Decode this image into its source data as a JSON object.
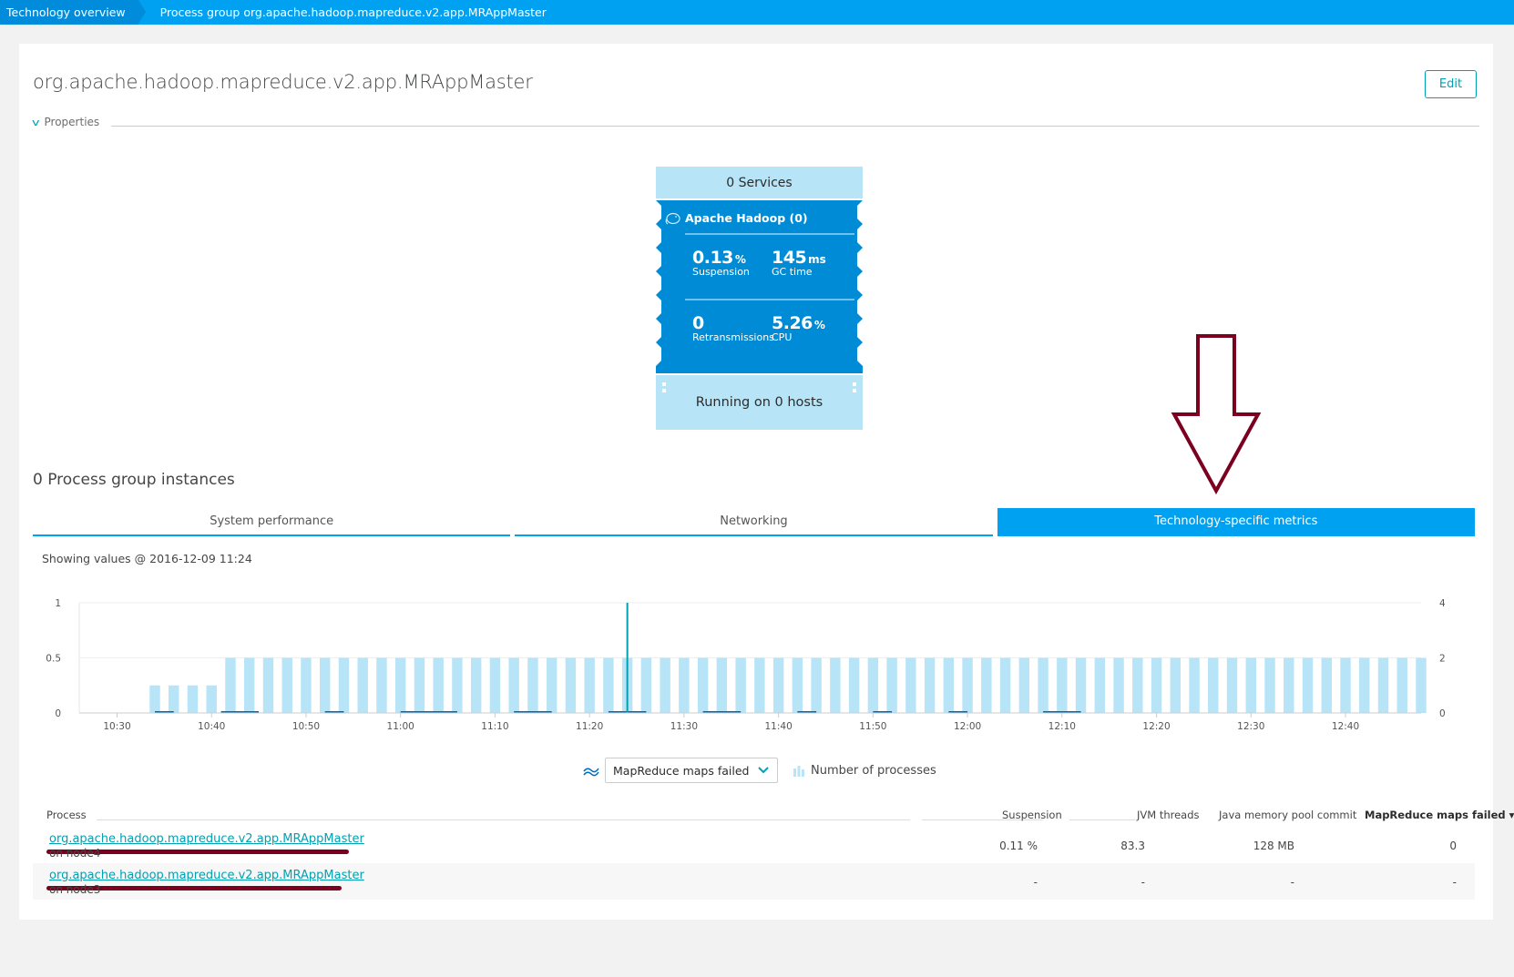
{
  "breadcrumb": {
    "items": [
      "Technology overview",
      "Process group org.apache.hadoop.mapreduce.v2.app.MRAppMaster"
    ]
  },
  "page": {
    "title": "org.apache.hadoop.mapreduce.v2.app.MRAppMaster",
    "edit_label": "Edit",
    "properties_label": "Properties"
  },
  "tile": {
    "services": "0 Services",
    "technology": "Apache Hadoop (0)",
    "metrics": [
      {
        "value": "0.13",
        "unit": "%",
        "label": "Suspension"
      },
      {
        "value": "145",
        "unit": "ms",
        "label": "GC time"
      },
      {
        "value": "0",
        "unit": "",
        "label": "Retransmissions"
      },
      {
        "value": "5.26",
        "unit": "%",
        "label": "CPU"
      }
    ],
    "hosts": "Running on 0 hosts",
    "color": "#008bd6",
    "light_color": "#b7e4f7"
  },
  "instances": {
    "title": "0 Process group instances",
    "tabs": [
      {
        "label": "System performance",
        "active": false
      },
      {
        "label": "Networking",
        "active": false
      },
      {
        "label": "Technology-specific metrics",
        "active": true
      }
    ],
    "showing": "Showing values @ 2016-12-09 11:24"
  },
  "legend": {
    "selected_metric": "MapReduce maps failed",
    "bar_series": "Number of processes"
  },
  "chart_data": {
    "type": "bar",
    "title": "",
    "xlabel": "",
    "ylabel_left": "MapReduce maps failed",
    "ylabel_right": "Number of processes",
    "x_ticks": [
      "10:30",
      "10:40",
      "10:50",
      "11:00",
      "11:10",
      "11:20",
      "11:30",
      "11:40",
      "11:50",
      "12:00",
      "12:10",
      "12:20",
      "12:30",
      "12:40"
    ],
    "ylim_left": [
      0,
      1
    ],
    "yticks_left": [
      "0",
      "0.5",
      "1"
    ],
    "ylim_right": [
      0,
      4
    ],
    "yticks_right": [
      "0",
      "2",
      "4"
    ],
    "x_start": "10:26",
    "x_end": "12:48",
    "bar_interval_minutes": 2,
    "series": [
      {
        "name": "Number of processes",
        "axis": "right",
        "kind": "bar",
        "color": "#b7e4f7",
        "start": "10:34",
        "values": [
          1,
          1,
          1,
          1,
          2,
          2,
          2,
          2,
          2,
          2,
          2,
          2,
          2,
          2,
          2,
          2,
          2,
          2,
          2,
          2,
          2,
          2,
          2,
          2,
          2,
          2,
          2,
          2,
          2,
          2,
          2,
          2,
          2,
          2,
          2,
          2,
          2,
          2,
          2,
          2,
          2,
          2,
          2,
          2,
          2,
          2,
          2,
          2,
          2,
          2,
          2,
          2,
          2,
          2,
          2,
          2,
          2,
          2,
          2,
          2,
          2,
          2,
          2,
          2,
          2,
          2,
          2,
          2
        ]
      },
      {
        "name": "MapReduce maps failed",
        "axis": "left",
        "kind": "line",
        "color": "#006bba",
        "segments": [
          [
            "10:34",
            "10:36"
          ],
          [
            "10:41",
            "10:45"
          ],
          [
            "10:52",
            "10:54"
          ],
          [
            "11:00",
            "11:06"
          ],
          [
            "11:12",
            "11:16"
          ],
          [
            "11:22",
            "11:26"
          ],
          [
            "11:32",
            "11:36"
          ],
          [
            "11:42",
            "11:44"
          ],
          [
            "11:50",
            "11:52"
          ],
          [
            "11:58",
            "12:00"
          ],
          [
            "12:08",
            "12:12"
          ]
        ],
        "values_note": "0 throughout visible segments",
        "marker": {
          "time": "11:24",
          "value": 1,
          "color": "#00a1b2"
        }
      }
    ]
  },
  "table": {
    "headers": [
      "Process",
      "Suspension",
      "JVM threads",
      "Java memory pool commit",
      "MapReduce maps failed ▾"
    ],
    "rows": [
      {
        "process": "org.apache.hadoop.mapreduce.v2.app.MRAppMaster",
        "node": "on node4",
        "suspension": "0.11 %",
        "jvm_threads": "83.3",
        "memory": "128 MB",
        "maps_failed": "0"
      },
      {
        "process": "org.apache.hadoop.mapreduce.v2.app.MRAppMaster",
        "node": "on node3",
        "suspension": "-",
        "jvm_threads": "-",
        "memory": "-",
        "maps_failed": "-"
      }
    ]
  },
  "annotation": {
    "arrow_color": "#7b0020",
    "underline_color": "#7b0020"
  }
}
